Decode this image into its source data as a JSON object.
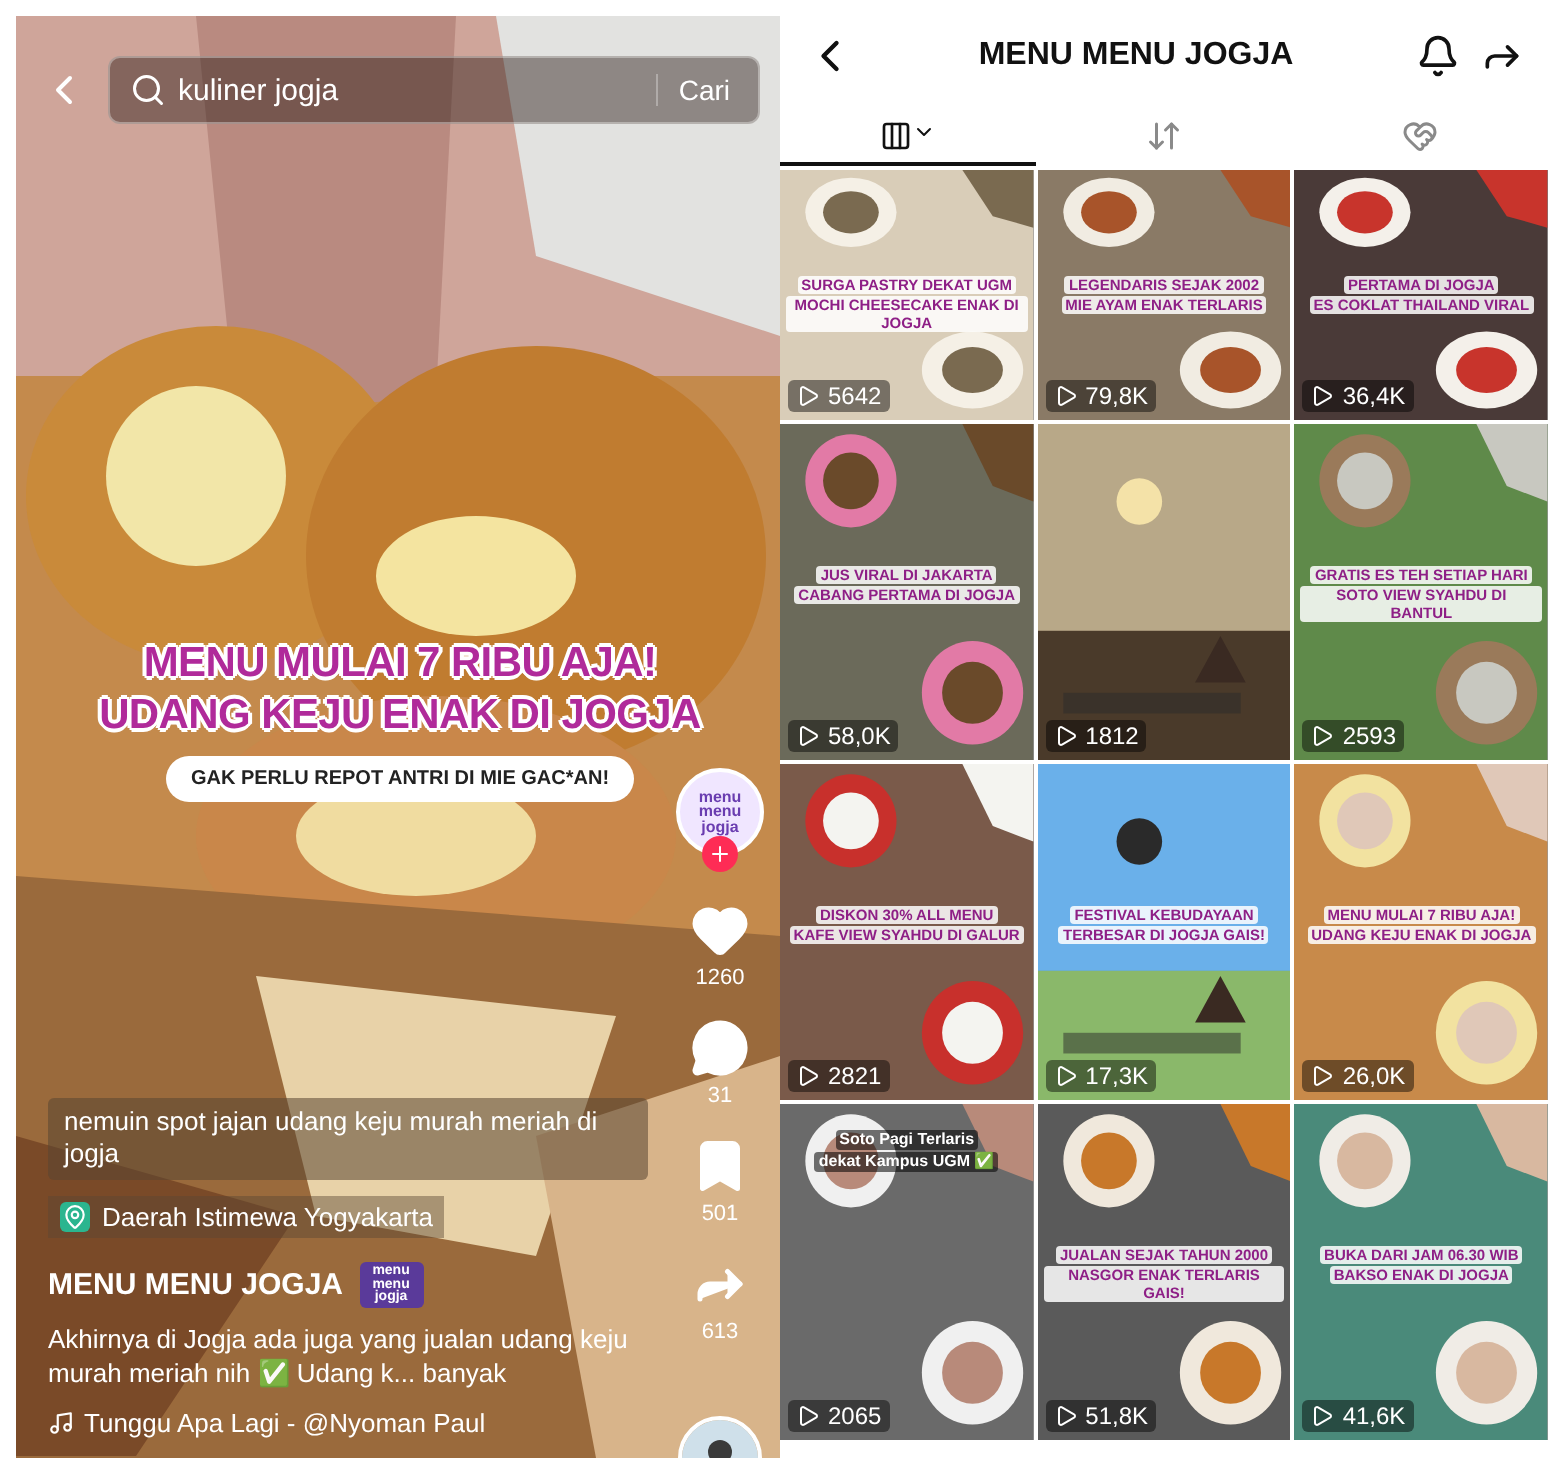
{
  "video": {
    "search": {
      "value": "kuliner jogja",
      "button": "Cari"
    },
    "headline": [
      "MENU MULAI 7 RIBU AJA!",
      "UDANG KEJU ENAK DI JOGJA"
    ],
    "subline": "GAK PERLU REPOT ANTRI DI MIE GAC*AN!",
    "creator_logo": "menu menu jogja",
    "actions": [
      {
        "kind": "like",
        "count": "1260"
      },
      {
        "kind": "comment",
        "count": "31"
      },
      {
        "kind": "save",
        "count": "501"
      },
      {
        "kind": "share",
        "count": "613"
      }
    ],
    "search_caption": "nemuin spot jajan udang keju murah meriah di jogja",
    "location": "Daerah Istimewa Yogyakarta",
    "author": "MENU MENU JOGJA",
    "author_badge": "menu menu jogja",
    "description": "Akhirnya di Jogja ada juga yang jualan udang keju murah meriah nih ✅  Udang k... banyak",
    "sound": "Tunggu Apa Lagi - @Nyoman Paul"
  },
  "profile": {
    "title": "MENU MENU JOGJA",
    "tabs": [
      {
        "kind": "videos",
        "selected": true
      },
      {
        "kind": "reposts",
        "selected": false
      },
      {
        "kind": "liked",
        "selected": false
      }
    ],
    "videos": [
      {
        "kind": "headline",
        "caption": [
          "SURGA PASTRY DEKAT UGM",
          "MOCHI CHEESECAKE ENAK DI JOGJA"
        ],
        "views": "5642"
      },
      {
        "kind": "headline",
        "caption": [
          "LEGENDARIS SEJAK 2002",
          "MIE AYAM ENAK TERLARIS"
        ],
        "views": "79,8K"
      },
      {
        "kind": "headline",
        "caption": [
          "PERTAMA DI JOGJA",
          "ES COKLAT THAILAND VIRAL"
        ],
        "views": "36,4K"
      },
      {
        "kind": "headline",
        "caption": [
          "JUS VIRAL DI JAKARTA",
          "CABANG PERTAMA DI JOGJA"
        ],
        "views": "58,0K"
      },
      {
        "views": "1812"
      },
      {
        "kind": "headline",
        "caption": [
          "GRATIS ES TEH SETIAP HARI",
          "SOTO VIEW SYAHDU DI BANTUL"
        ],
        "views": "2593"
      },
      {
        "kind": "headline",
        "caption": [
          "DISKON 30% ALL MENU",
          "KAFE VIEW SYAHDU DI GALUR"
        ],
        "views": "2821"
      },
      {
        "kind": "headline",
        "caption": [
          "FESTIVAL KEBUDAYAAN",
          "TERBESAR DI JOGJA GAIS!"
        ],
        "views": "17,3K"
      },
      {
        "kind": "headline",
        "caption": [
          "MENU MULAI 7 RIBU AJA!",
          "UDANG KEJU ENAK DI JOGJA"
        ],
        "views": "26,0K"
      },
      {
        "kind": "plain",
        "caption": [
          "Soto Pagi Terlaris",
          "dekat Kampus UGM ✅"
        ],
        "views": "2065"
      },
      {
        "kind": "headline",
        "caption": [
          "JUALAN SEJAK TAHUN 2000",
          "NASGOR ENAK TERLARIS GAIS!"
        ],
        "views": "51,8K"
      },
      {
        "kind": "headline",
        "caption": [
          "BUKA DARI JAM 06.30 WIB",
          "BAKSO ENAK DI JOGJA"
        ],
        "views": "41,6K"
      }
    ]
  }
}
